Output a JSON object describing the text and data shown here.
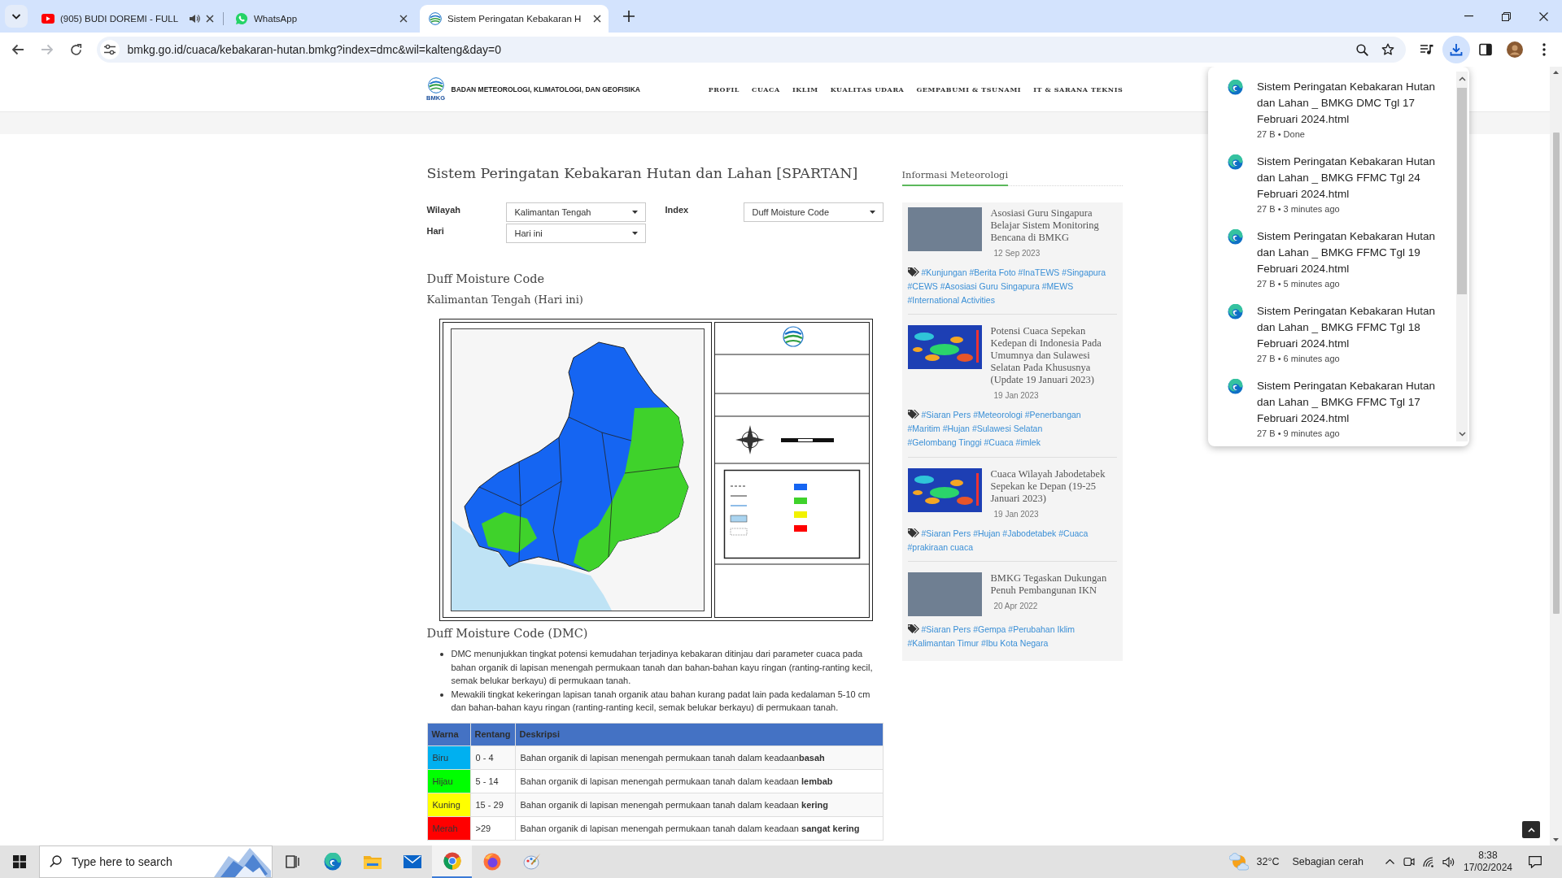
{
  "browser": {
    "tabs": [
      {
        "title": "(905) BUDI DOREMI - FULL",
        "kind": "video",
        "audio": true,
        "selected": false
      },
      {
        "title": "WhatsApp",
        "kind": "chat",
        "audio": false,
        "selected": false
      },
      {
        "title": "Sistem Peringatan Kebakaran H",
        "kind": "site",
        "audio": false,
        "selected": true
      }
    ],
    "nav_buttons": [
      {
        "kind": "back",
        "disabled": false
      },
      {
        "kind": "forward",
        "disabled": true
      },
      {
        "kind": "reload",
        "disabled": false
      }
    ],
    "address": "bmkg.go.id/cuaca/kebakaran-hutan.bmkg?index=dmc&wil=kalteng&day=0",
    "toolbar_buttons": [
      {
        "kind": "media",
        "active": false
      },
      {
        "kind": "download",
        "active": true
      },
      {
        "kind": "side-panel",
        "active": false
      },
      {
        "kind": "profile",
        "active": false
      },
      {
        "kind": "menu",
        "active": false
      }
    ],
    "downloads": [
      {
        "name": "Sistem Peringatan Kebakaran Hutan dan Lahan _ BMKG DMC Tgl 17 Februari 2024.html",
        "meta": "27 B • Done"
      },
      {
        "name": "Sistem Peringatan Kebakaran Hutan dan Lahan _ BMKG FFMC Tgl 24 Februari 2024.html",
        "meta": "27 B • 3 minutes ago"
      },
      {
        "name": "Sistem Peringatan Kebakaran Hutan dan Lahan _ BMKG FFMC Tgl 19 Februari 2024.html",
        "meta": "27 B • 5 minutes ago"
      },
      {
        "name": "Sistem Peringatan Kebakaran Hutan dan Lahan _ BMKG FFMC Tgl 18 Februari 2024.html",
        "meta": "27 B • 6 minutes ago"
      },
      {
        "name": "Sistem Peringatan Kebakaran Hutan dan Lahan _ BMKG FFMC Tgl 17 Februari 2024.html",
        "meta": "27 B • 9 minutes ago"
      }
    ]
  },
  "site": {
    "logo_text": "BMKG",
    "org_name": "BADAN METEOROLOGI, KLIMATOLOGI, DAN GEOFISIKA",
    "nav": [
      "PROFIL",
      "CUACA",
      "IKLIM",
      "KUALITAS UDARA",
      "GEMPABUMI & TSUNAMI",
      "IT & SARANA TEKNIS"
    ]
  },
  "page": {
    "title": "Sistem Peringatan Kebakaran Hutan dan Lahan [SPARTAN]",
    "filters": [
      {
        "label": "Wilayah",
        "value": "Kalimantan Tengah"
      },
      {
        "label": "Hari",
        "value": "Hari ini"
      },
      {
        "label": "Index",
        "value": "Duff Moisture Code"
      }
    ],
    "heading": "Duff Moisture Code",
    "subheading": "Kalimantan Tengah (Hari ini)",
    "section_title": "Duff Moisture Code (DMC)",
    "bullets": [
      "DMC menunjukkan tingkat potensi kemudahan terjadinya kebakaran ditinjau dari parameter cuaca pada bahan organik di lapisan menengah permukaan tanah dan bahan-bahan kayu ringan (ranting-ranting kecil, semak belukar berkayu) di permukaan tanah.",
      "Mewakili tingkat kekeringan lapisan tanah organik atau bahan kurang padat lain pada kedalaman 5-10 cm dan bahan-bahan kayu ringan (ranting-ranting kecil, semak belukar berkayu) di permukaan tanah."
    ],
    "table": {
      "columns": [
        "Warna",
        "Rentang",
        "Deskripsi"
      ],
      "rows": [
        {
          "color": "#00b0f0",
          "label": "Biru",
          "range": "0 - 4",
          "description": "Bahan organik di lapisan menengah permukaan tanah dalam keadaan**basah**"
        },
        {
          "color": "#00ff00",
          "label": "Hijau",
          "range": "5 - 14",
          "description": "Bahan organik di lapisan menengah permukaan tanah dalam keadaan **lembab**"
        },
        {
          "color": "#ffff00",
          "label": "Kuning",
          "range": "15 - 29",
          "description": "Bahan organik di lapisan menengah permukaan tanah dalam keadaan **kering**"
        },
        {
          "color": "#ff0000",
          "label": "Merah",
          "range": ">29",
          "description": "Bahan organik di lapisan menengah permukaan tanah dalam keadaan **sangat kering**"
        }
      ]
    }
  },
  "sidebar": {
    "title": "Informasi Meteorologi",
    "posts": [
      {
        "kind": "photo",
        "title": "Asosiasi Guru Singapura Belajar Sistem Monitoring Bencana di BMKG",
        "date": "12 Sep 2023",
        "tags": [
          "#Kunjungan",
          "#Berita Foto",
          "#InaTEWS",
          "#Singapura",
          "#CEWS",
          "#Asosiasi Guru Singapura",
          "#MEWS",
          "#International Activities"
        ]
      },
      {
        "kind": "weather-map",
        "title": "Potensi Cuaca Sepekan Kedepan di Indonesia Pada Umumnya dan Sulawesi Selatan Pada Khususnya (Update 19 Januari 2023)",
        "date": "19 Jan 2023",
        "tags": [
          "#Siaran Pers",
          "#Meteorologi",
          "#Penerbangan",
          "#Maritim",
          "#Hujan",
          "#Sulawesi Selatan",
          "#Gelombang Tinggi",
          "#Cuaca",
          "#imlek"
        ]
      },
      {
        "kind": "weather-map",
        "title": "Cuaca Wilayah Jabodetabek Sepekan ke Depan (19-25 Januari 2023)",
        "date": "19 Jan 2023",
        "tags": [
          "#Siaran Pers",
          "#Hujan",
          "#Jabodetabek",
          "#Cuaca",
          "#prakiraan cuaca"
        ]
      },
      {
        "kind": "photo",
        "title": "BMKG Tegaskan Dukungan Penuh Pembangunan IKN",
        "date": "20 Apr 2022",
        "tags": [
          "#Siaran Pers",
          "#Gempa",
          "#Perubahan Iklim",
          "#Kalimantan Timur",
          "#Ibu Kota Negara"
        ]
      }
    ]
  },
  "taskbar": {
    "search_placeholder": "Type here to search",
    "apps": [
      {
        "kind": "task-view",
        "active": false
      },
      {
        "kind": "edge",
        "active": false
      },
      {
        "kind": "files",
        "active": false
      },
      {
        "kind": "mail",
        "active": false
      },
      {
        "kind": "chrome",
        "active": true
      },
      {
        "kind": "firefox",
        "active": false
      },
      {
        "kind": "paint",
        "active": false
      }
    ],
    "weather": {
      "temperature": "32°C",
      "condition": "Sebagian cerah"
    },
    "time": "8:38",
    "date": "17/02/2024"
  }
}
